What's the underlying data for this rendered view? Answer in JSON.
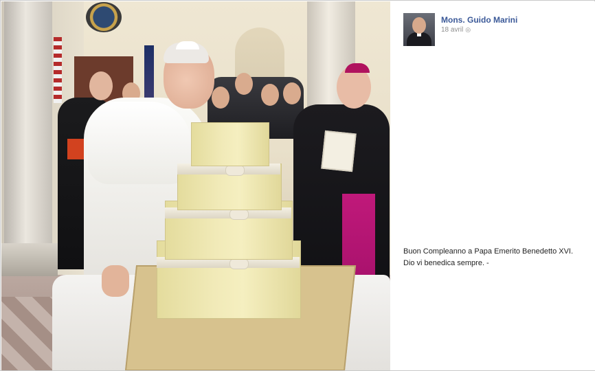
{
  "post": {
    "author_name": "Mons. Guido Marini",
    "date": "18 avril",
    "privacy_icon": "globe-icon",
    "caption_line1": "Buon Compleanno a Papa Emerito Benedetto XVI.",
    "caption_line2": "Dio vi benedica sempre. -"
  },
  "photo": {
    "description_icon": "photo",
    "colors": {
      "cake": "#f1eab8",
      "cardinal_sash": "#c0197a",
      "author_link": "#3b5998"
    }
  }
}
